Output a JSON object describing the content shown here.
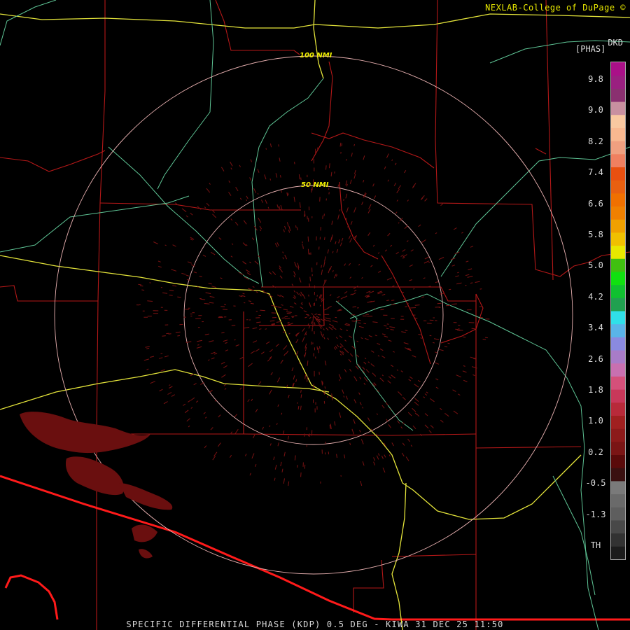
{
  "credit": "NEXLAB-College of DuPage ©",
  "footer": "SPECIFIC DIFFERENTIAL PHASE (KDP) 0.5 DEG - KIWA 31 DEC 25 11:50",
  "legend": {
    "unit_line1": "DKD",
    "unit_line2": "[PHAS]",
    "ticks": [
      "9.8",
      "9.0",
      "8.2",
      "7.4",
      "6.6",
      "5.8",
      "5.0",
      "4.2",
      "3.4",
      "2.6",
      "1.8",
      "1.0",
      "0.2",
      "-0.5",
      "-1.3",
      "TH"
    ],
    "colors": [
      "#1c1c1c",
      "#323232",
      "#484848",
      "#5e5e5e",
      "#6a6a6a",
      "#7a7a7a",
      "#3a1010",
      "#5a0a0a",
      "#7a1515",
      "#8c1a1a",
      "#a02020",
      "#b82a3a",
      "#c8385a",
      "#d4507a",
      "#c870b0",
      "#a87cc8",
      "#8a8ae0",
      "#5ab4e8",
      "#30e0e8",
      "#20a050",
      "#10c030",
      "#10e010",
      "#40c010",
      "#e8e800",
      "#f0c000",
      "#f0a000",
      "#f08000",
      "#f07000",
      "#e86010",
      "#e85010",
      "#f08060",
      "#f0a080",
      "#f8b890",
      "#f8c8a0",
      "#c890a0",
      "#8a3070",
      "#9a2080",
      "#aa1088"
    ]
  },
  "range_rings": [
    {
      "label": "100 NMI"
    },
    {
      "label": "50 NMI"
    }
  ]
}
